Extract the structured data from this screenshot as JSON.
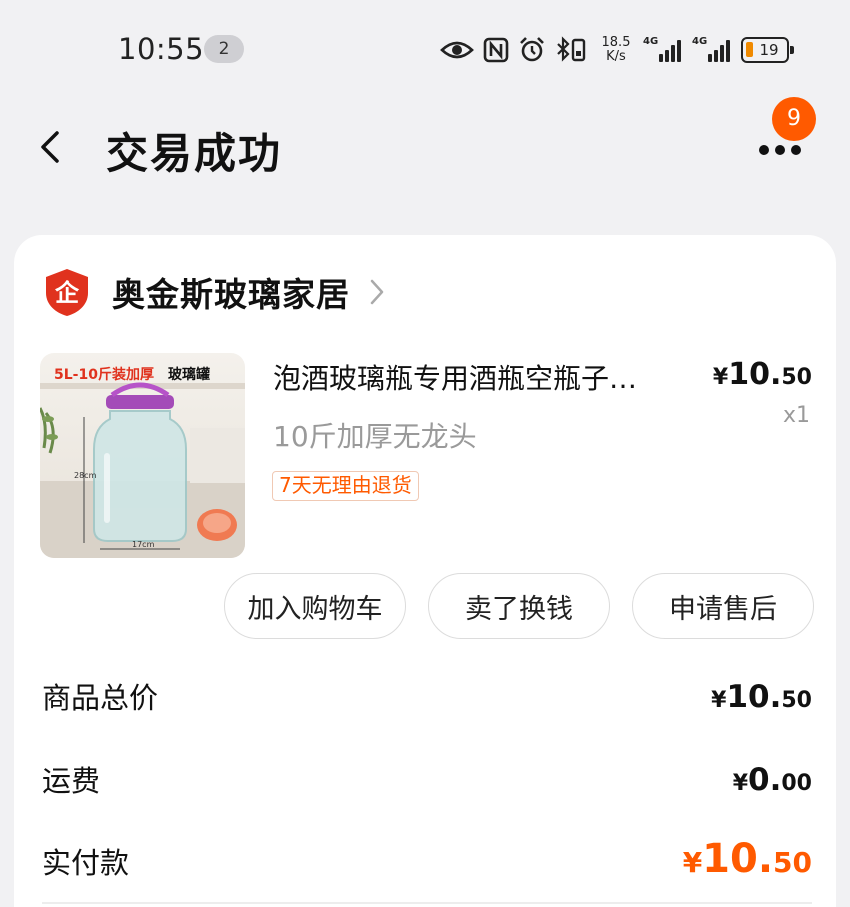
{
  "status_bar": {
    "time": "10:55",
    "notification_count": "2",
    "net_speed_value": "18.5",
    "net_speed_unit": "K/s",
    "signal1_label": "4G",
    "signal2_label": "4G",
    "battery_level": "19",
    "icons": [
      "eye-icon",
      "nfc-icon",
      "alarm-icon",
      "bluetooth-vibrate-icon",
      "signal-icon",
      "battery-icon"
    ]
  },
  "header": {
    "title": "交易成功",
    "more_badge": "9"
  },
  "shop": {
    "name": "奥金斯玻璃家居",
    "logo_char": "企"
  },
  "product": {
    "image_banner_a": "5L-10斤装加厚",
    "image_banner_b": "玻璃罐",
    "image_height_label": "28cm",
    "image_width_label": "17cm",
    "title": "泡酒玻璃瓶专用酒瓶空瓶子…",
    "spec": "10斤加厚无龙头",
    "return_tag": "7天无理由退货",
    "price_currency": "¥",
    "price_int": "10.",
    "price_dec": "50",
    "quantity": "x1"
  },
  "actions": {
    "add_to_cart": "加入购物车",
    "sell": "卖了换钱",
    "after_sales": "申请售后"
  },
  "summary": {
    "total_label": "商品总价",
    "total_currency": "¥",
    "total_int": "10.",
    "total_dec": "50",
    "shipping_label": "运费",
    "shipping_currency": "¥",
    "shipping_int": "0.",
    "shipping_dec": "00",
    "paid_label": "实付款",
    "paid_currency": "¥",
    "paid_int": "10.",
    "paid_dec": "50"
  },
  "colors": {
    "accent": "#ff5a00",
    "shop_logo": "#e0321e",
    "background": "#f1f1f3"
  }
}
